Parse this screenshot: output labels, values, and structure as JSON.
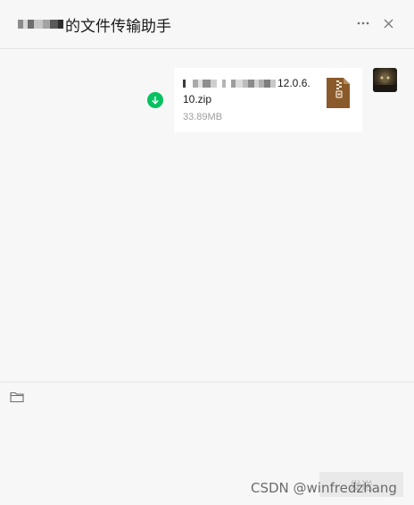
{
  "header": {
    "title_prefix": "",
    "title": "的文件传输助手",
    "menu_icon": "more-dots-icon",
    "close_icon": "close-icon"
  },
  "message": {
    "file_name_line1": "12.0.6.",
    "file_name_line2": "10.zip",
    "file_size": "33.89MB",
    "file_icon": "zip-file-icon",
    "status_icon": "download-icon",
    "colors": {
      "download": "#07c160",
      "zip": "#8a5a2b"
    }
  },
  "composer": {
    "folder_icon": "folder-icon",
    "send_label": "发送"
  },
  "watermark": "CSDN @winfredzhang"
}
